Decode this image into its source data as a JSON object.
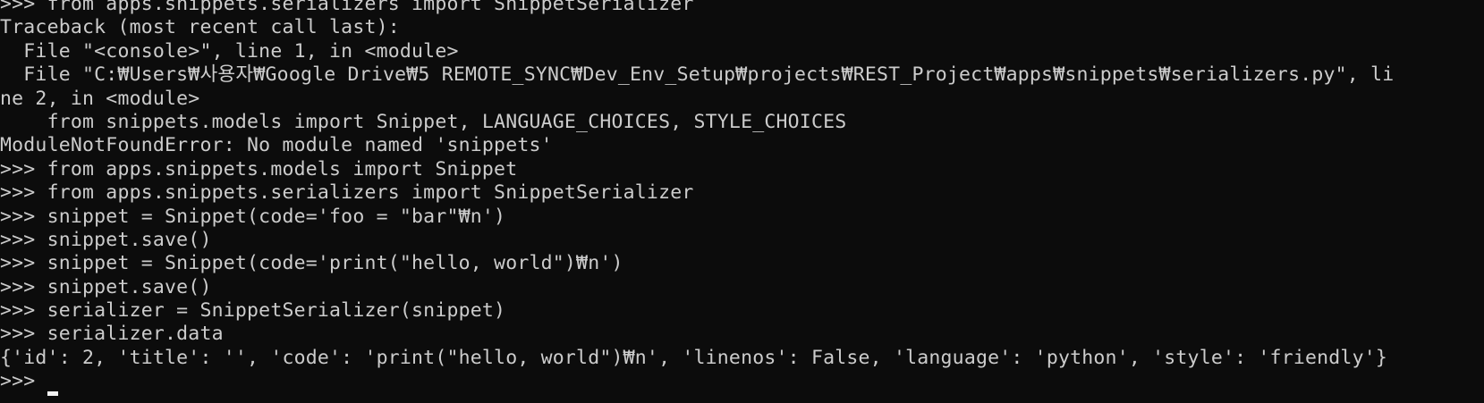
{
  "colors": {
    "background": "#0c0c0c",
    "text": "#cccccc",
    "cursor": "#f2f2f2"
  },
  "console": {
    "lines": [
      ">>> from apps.snippets.serializers import SnippetSerializer",
      "Traceback (most recent call last):",
      "  File \"<console>\", line 1, in <module>",
      "  File \"C:₩Users₩사용자₩Google Drive₩5 REMOTE_SYNC₩Dev_Env_Setup₩projects₩REST_Project₩apps₩snippets₩serializers.py\", li",
      "ne 2, in <module>",
      "    from snippets.models import Snippet, LANGUAGE_CHOICES, STYLE_CHOICES",
      "ModuleNotFoundError: No module named 'snippets'",
      ">>> from apps.snippets.models import Snippet",
      ">>> from apps.snippets.serializers import SnippetSerializer",
      ">>> snippet = Snippet(code='foo = \"bar\"₩n')",
      ">>> snippet.save()",
      ">>> snippet = Snippet(code='print(\"hello, world\")₩n')",
      ">>> snippet.save()",
      ">>> serializer = SnippetSerializer(snippet)",
      ">>> serializer.data",
      "{'id': 2, 'title': '', 'code': 'print(\"hello, world\")₩n', 'linenos': False, 'language': 'python', 'style': 'friendly'}"
    ],
    "prompt": ">>> "
  }
}
